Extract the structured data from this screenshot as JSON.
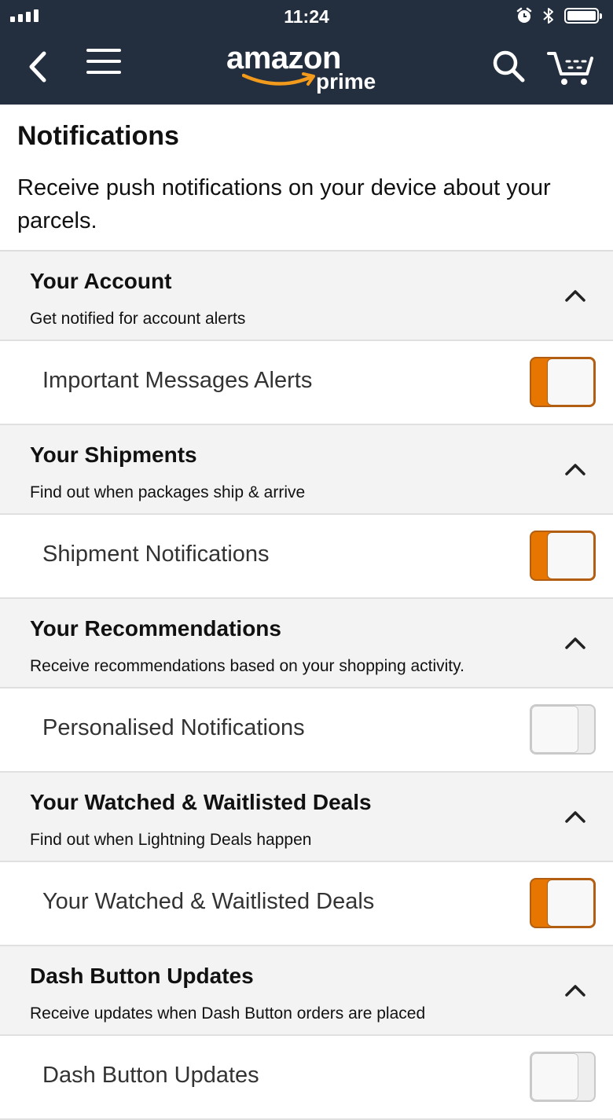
{
  "status_bar": {
    "time": "11:24",
    "icons": [
      "signal-icon",
      "alarm-icon",
      "bluetooth-icon",
      "battery-icon"
    ]
  },
  "header": {
    "logo_text": "amazon",
    "logo_sub": "prime",
    "background": "#232f3e",
    "icons": [
      "back-icon",
      "menu-icon",
      "search-icon",
      "cart-icon"
    ]
  },
  "page": {
    "title": "Notifications",
    "description": "Receive push notifications on your device about your parcels."
  },
  "colors": {
    "accent": "#e77600",
    "section_bg": "#f3f3f3"
  },
  "sections": [
    {
      "title": "Your Account",
      "subtitle": "Get notified for account alerts",
      "expanded": true,
      "row_label": "Important Messages Alerts",
      "enabled": true
    },
    {
      "title": "Your Shipments",
      "subtitle": "Find out when packages ship & arrive",
      "expanded": true,
      "row_label": "Shipment Notifications",
      "enabled": true
    },
    {
      "title": "Your Recommendations",
      "subtitle": "Receive recommendations based on your shopping activity.",
      "expanded": true,
      "row_label": "Personalised Notifications",
      "enabled": false
    },
    {
      "title": "Your Watched & Waitlisted Deals",
      "subtitle": "Find out when Lightning Deals happen",
      "expanded": true,
      "row_label": "Your Watched & Waitlisted Deals",
      "enabled": true
    },
    {
      "title": "Dash Button Updates",
      "subtitle": "Receive updates when Dash Button orders are placed",
      "expanded": true,
      "row_label": "Dash Button Updates",
      "enabled": false
    }
  ]
}
